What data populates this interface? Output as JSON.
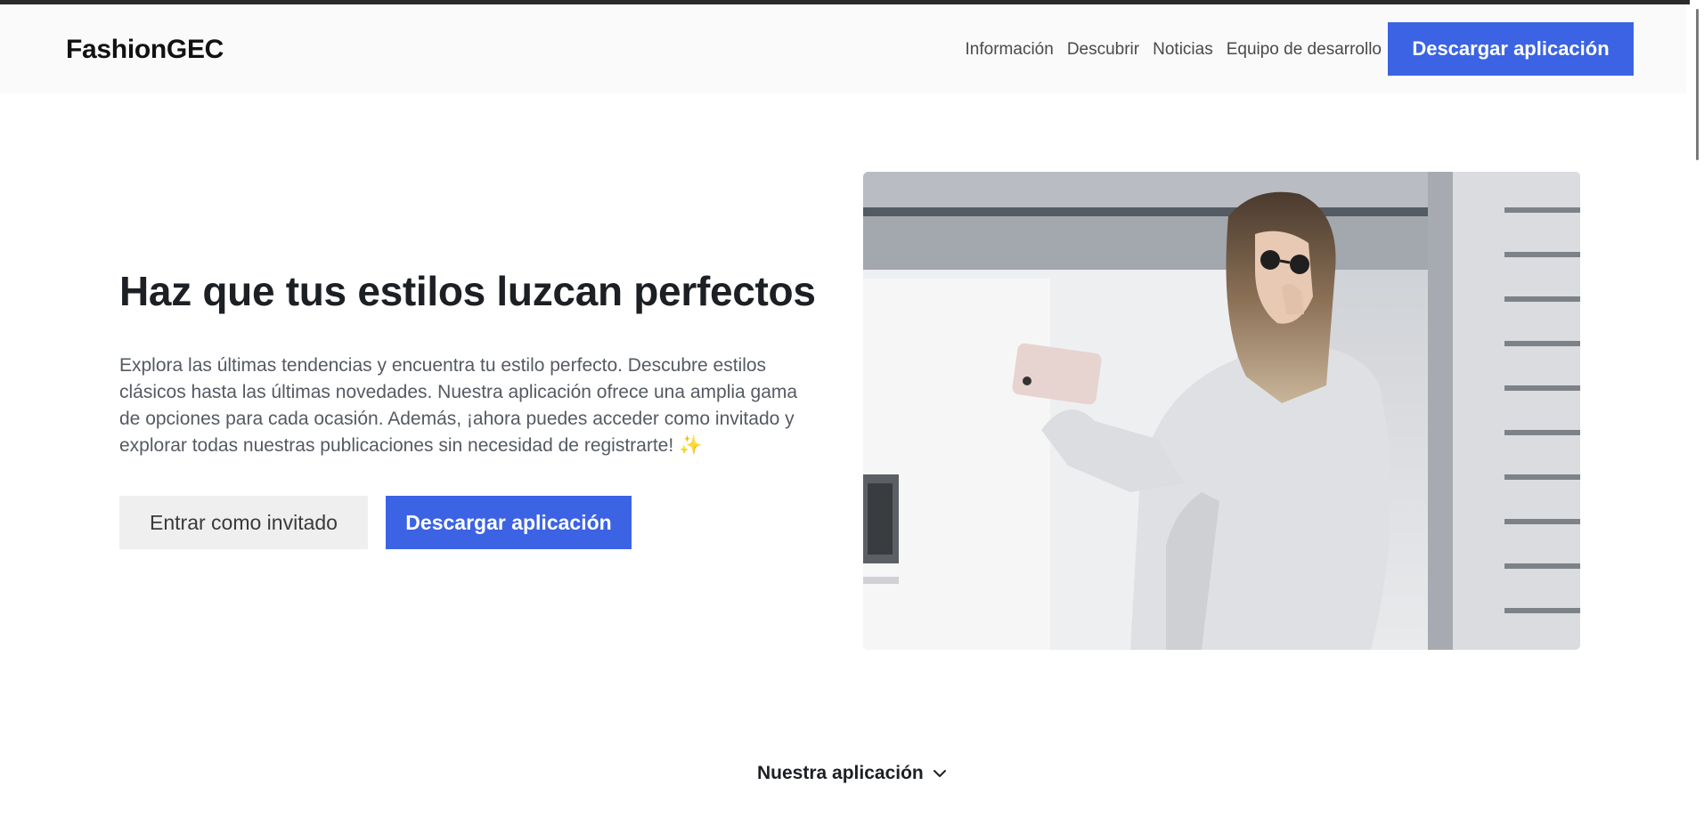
{
  "header": {
    "brand": "FashionGEC",
    "nav": [
      {
        "label": "Información"
      },
      {
        "label": "Descubrir"
      },
      {
        "label": "Noticias"
      },
      {
        "label": "Equipo de desarrollo"
      }
    ],
    "cta_label": "Descargar aplicación"
  },
  "hero": {
    "title": "Haz que tus estilos luzcan perfectos",
    "description": "Explora las últimas tendencias y encuentra tu estilo perfecto. Descubre estilos clásicos hasta las últimas novedades. Nuestra aplicación ofrece una amplia gama de opciones para cada ocasión. Además, ¡ahora puedes acceder como invitado y explorar todas nuestras publicaciones sin necesidad de registrarte! ✨",
    "guest_button": "Entrar como invitado",
    "download_button": "Descargar aplicación"
  },
  "section_toggle": {
    "label": "Nuestra aplicación",
    "icon": "chevron-down-icon"
  },
  "colors": {
    "accent": "#3b63e3",
    "nav_bg": "#fafafa",
    "secondary_button": "#efefef"
  }
}
